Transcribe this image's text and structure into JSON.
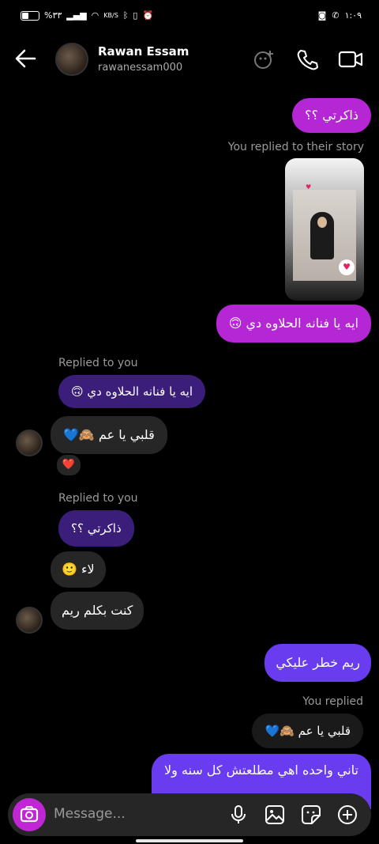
{
  "status_bar": {
    "battery": "%٣٣",
    "data_rate": "KB/S",
    "time": "١:٠٩"
  },
  "header": {
    "name": "Rawan Essam",
    "username": "rawanessam000"
  },
  "messages": {
    "m1": "ذاكرتي ؟؟",
    "story_reply_note": "You replied to their story",
    "m2": "ايه يا فنانه الحلاوه دي 🙃",
    "replied_to_you_1": "Replied to you",
    "quote1": "ايه يا فنانه الحلاوه دي 🙃",
    "m3": "قلبي يا عم 🙈💙",
    "reaction": "❤️",
    "replied_to_you_2": "Replied to you",
    "quote2": "ذاكرتي ؟؟",
    "m4": "لاء 🙂",
    "m5": "كنت بكلم ريم",
    "m6": "ريم خطر عليكي",
    "you_replied": "You replied",
    "quote3": "قلبي يا عم 🙈💙",
    "m7": "تاني واحده اهي مطلعتش كل سنه ولا"
  },
  "composer": {
    "placeholder": "Message..."
  },
  "colors": {
    "accent_pink": "#b526d4",
    "accent_violet": "#6a3cf0",
    "quote_bg": "#3b1e7a",
    "incoming_bg": "#262626"
  }
}
